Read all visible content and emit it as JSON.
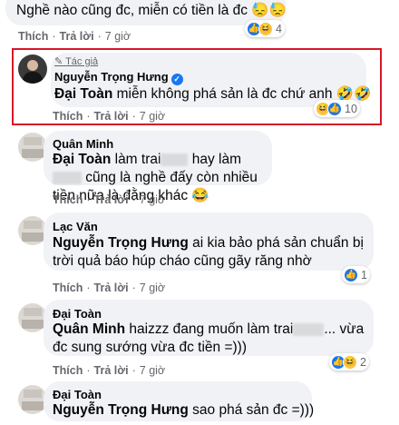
{
  "top_comment": {
    "text": "Nghề nào cũng đc, miễn có tiền là đc",
    "emoji": "😓😓",
    "reactions": "4"
  },
  "top_actions": {
    "like": "Thích",
    "reply": "Trả lời",
    "time": "7 giờ"
  },
  "comments": [
    {
      "author_badge": "Tác giả",
      "name": "Nguyễn Trọng Hưng",
      "verified": true,
      "tag": "Đại Toàn",
      "text": " miễn không phá sản là đc chứ anh 🤣🤣",
      "reactions": "10",
      "like": "Thích",
      "reply": "Trả lời",
      "time": "7 giờ"
    },
    {
      "name": "Quân Minh",
      "tag": "Đại Toàn",
      "text_a": " làm trai",
      "text_b": " hay làm ",
      "text_c": " cũng là nghề đấy còn nhiều tiền nữa là đằng khác 😂",
      "like": "Thích",
      "reply": "Trả lời",
      "time": "7 giờ"
    },
    {
      "name": "Lạc Văn",
      "tag": "Nguyễn Trọng Hưng",
      "text": " ai kia bảo phá sản chuẩn bị trời quả báo húp cháo cũng gãy răng nhờ",
      "reactions": "1",
      "like": "Thích",
      "reply": "Trả lời",
      "time": "7 giờ"
    },
    {
      "name": "Đại Toàn",
      "tag": "Quân Minh",
      "text_a": " haizzz đang muốn làm trai",
      "text_b": "... vừa đc sung sướng vừa đc tiền =)))",
      "reactions": "2",
      "like": "Thích",
      "reply": "Trả lời",
      "time": "7 giờ"
    },
    {
      "name": "Đại Toàn",
      "tag": "Nguyễn Trọng Hưng",
      "text": " sao phá sản đc =)))"
    }
  ],
  "colors": {
    "highlight": "#d7172a",
    "bubble": "#f0f2f5",
    "like": "#1877f2"
  },
  "icons": [
    "pencil-icon",
    "verified-icon",
    "haha-reaction-icon",
    "like-reaction-icon"
  ]
}
